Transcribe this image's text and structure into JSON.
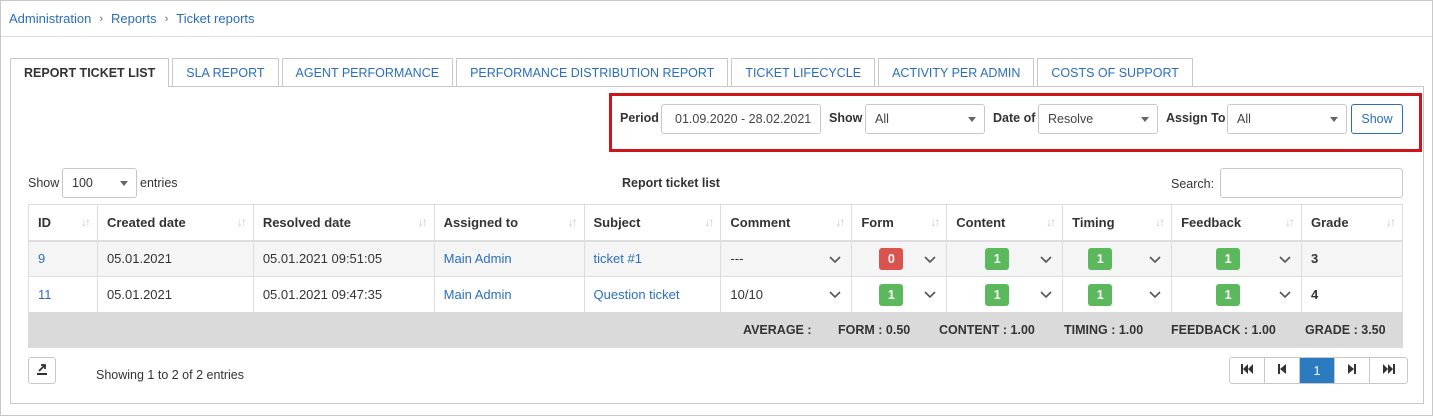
{
  "breadcrumb": [
    "Administration",
    "Reports",
    "Ticket reports"
  ],
  "tabs": [
    {
      "label": "REPORT TICKET LIST",
      "active": true
    },
    {
      "label": "SLA REPORT"
    },
    {
      "label": "AGENT PERFORMANCE"
    },
    {
      "label": "PERFORMANCE DISTRIBUTION REPORT"
    },
    {
      "label": "TICKET LIFECYCLE"
    },
    {
      "label": "ACTIVITY PER ADMIN"
    },
    {
      "label": "COSTS OF SUPPORT"
    }
  ],
  "filters": {
    "period_label": "Period",
    "period_value": "01.09.2020 - 28.02.2021",
    "show_label": "Show",
    "show_value": "All",
    "date_of_label": "Date of",
    "date_of_value": "Resolve",
    "assign_to_label": "Assign To",
    "assign_to_value": "All",
    "submit_label": "Show"
  },
  "table_controls": {
    "show_label": "Show",
    "entries_value": "100",
    "entries_label": "entries",
    "title": "Report ticket list",
    "search_label": "Search:"
  },
  "columns": [
    "ID",
    "Created date",
    "Resolved date",
    "Assigned to",
    "Subject",
    "Comment",
    "Form",
    "Content",
    "Timing",
    "Feedback",
    "Grade"
  ],
  "rows": [
    {
      "id": "9",
      "created": "05.01.2021",
      "resolved": "05.01.2021 09:51:05",
      "assigned": "Main Admin",
      "subject": "ticket #1",
      "comment": "---",
      "form": "0",
      "content": "1",
      "timing": "1",
      "feedback": "1",
      "grade": "3"
    },
    {
      "id": "11",
      "created": "05.01.2021",
      "resolved": "05.01.2021 09:47:35",
      "assigned": "Main Admin",
      "subject": "Question ticket",
      "comment": "10/10",
      "form": "1",
      "content": "1",
      "timing": "1",
      "feedback": "1",
      "grade": "4"
    }
  ],
  "footer": {
    "average": "AVERAGE :",
    "form": "FORM : 0.50",
    "content": "CONTENT : 1.00",
    "timing": "TIMING : 1.00",
    "feedback": "FEEDBACK : 1.00",
    "grade": "GRADE : 3.50"
  },
  "info": "Showing 1 to 2 of 2 entries",
  "pagination": {
    "current": "1"
  },
  "colors": {
    "link": "#2a6ebb",
    "badge_red": "#d9534f",
    "badge_green": "#5cb85c",
    "highlight_border": "#d0141b"
  }
}
